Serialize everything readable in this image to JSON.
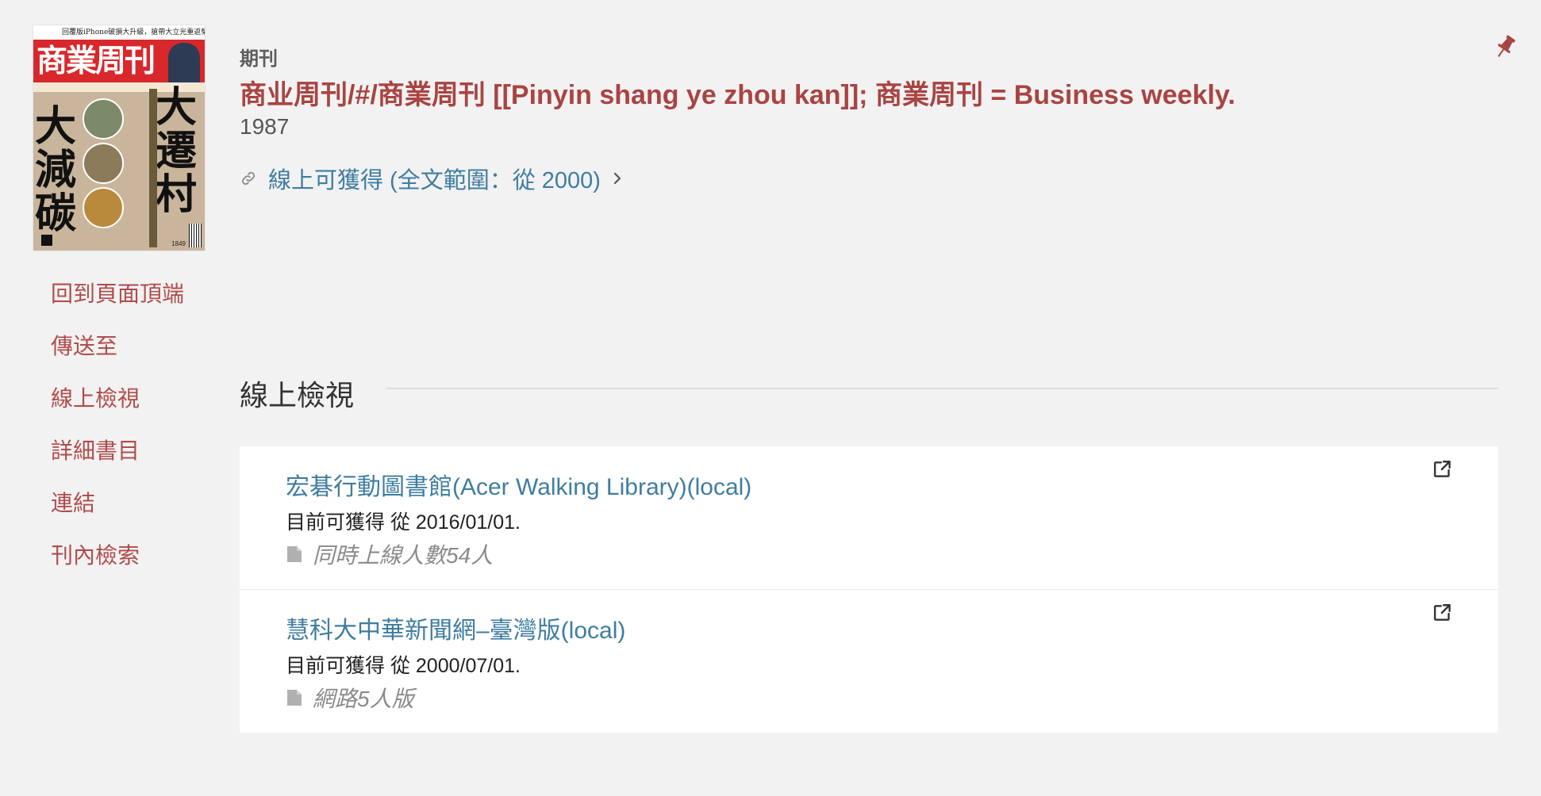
{
  "cover": {
    "top_line": "回覆版iPhone破損大升級，搶帶大立光重返榮耀？",
    "logo": "商業周刊",
    "headline_left": "大減碳",
    "headline_right": "大遷村",
    "issue_number": "1849"
  },
  "nav": {
    "items": [
      {
        "label": "回到頁面頂端"
      },
      {
        "label": "傳送至"
      },
      {
        "label": "線上檢視"
      },
      {
        "label": "詳細書目"
      },
      {
        "label": "連結"
      },
      {
        "label": "刊內檢索"
      }
    ]
  },
  "record": {
    "type": "期刊",
    "title": "商业周刊/#/商業周刊 [[Pinyin shang ye zhou kan]]; 商業周刊 = Business weekly.",
    "year": "1987",
    "availability_link": "線上可獲得 (全文範圍：從 2000)"
  },
  "section": {
    "title": "線上檢視"
  },
  "services": [
    {
      "name": "宏碁行動圖書館(Acer Walking Library)(local)",
      "availability": "目前可獲得 從 2016/01/01.",
      "note": "同時上線人數54人"
    },
    {
      "name": "慧科大中華新聞網–臺灣版(local)",
      "availability": "目前可獲得 從 2000/07/01.",
      "note": "網路5人版"
    }
  ],
  "colors": {
    "background": "#f2f2f2",
    "accent_red": "#a94442",
    "nav_red": "#b04c4c",
    "link_blue": "#3f7da0"
  }
}
